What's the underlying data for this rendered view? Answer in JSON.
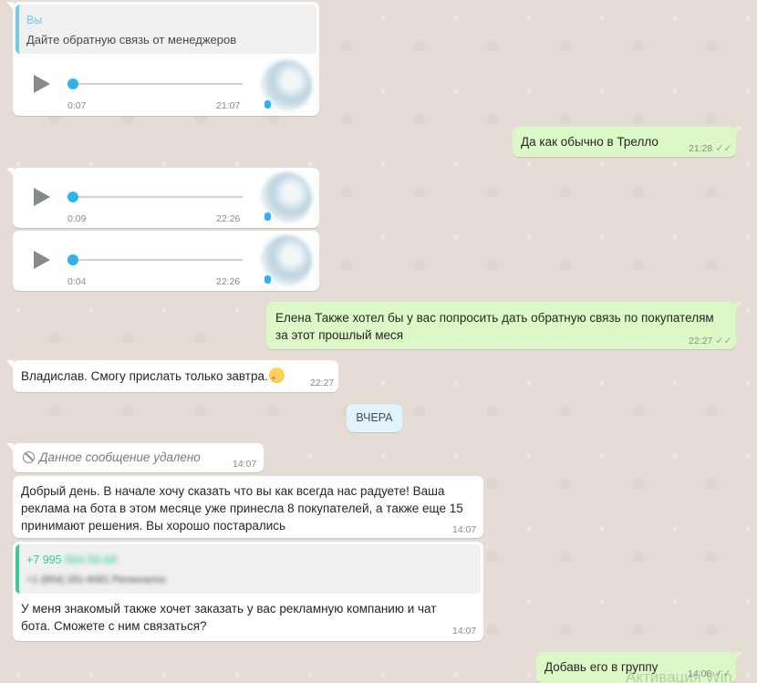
{
  "chat": {
    "msg1": {
      "quote_author": "Вы",
      "quote_text": "Дайте обратную связь от менеджеров",
      "voice_duration": "0:07",
      "time": "21:07"
    },
    "msg2": {
      "text": "Да как обычно в Трелло",
      "time": "21:28"
    },
    "msg3": {
      "voice_duration": "0:09",
      "time": "22:26"
    },
    "msg4": {
      "voice_duration": "0:04",
      "time": "22:26"
    },
    "msg5": {
      "line1": "Елена Также хотел бы у вас попросить дать обратную связь по покупателям",
      "line2": "за этот прошлый меся",
      "time": "22:27"
    },
    "msg6": {
      "text": "Владислав. Смогу прислать только завтра.",
      "time": "22:27"
    },
    "date_separator": "ВЧЕРА",
    "msg7": {
      "text": "Данное сообщение удалено",
      "time": "14:07"
    },
    "msg8": {
      "line1": "Добрый день. В начале хочу сказать что вы как всегда нас радуете! Ваша",
      "line2": "реклама на бота в этом месяце уже принесла 8 покупателей, а также еще 15",
      "line3": "принимают решения. Вы хорошо постарались",
      "time": "14:07"
    },
    "msg9": {
      "quote_phone": "+7 995",
      "quote_phone_hidden": "564-59-68",
      "quote_sub_hidden": "+1 (854) 281-6081 Регионалос",
      "line1": "У меня знакомый также хочет заказать у вас рекламную компанию и чат",
      "line2": "бота. Сможете с ним связаться?",
      "time": "14:07"
    },
    "msg10": {
      "text": "Добавь его в группу",
      "time": "14:08"
    }
  },
  "watermark": "Активация Win",
  "colors": {
    "background": "#e5ddd5",
    "incoming": "#ffffff",
    "outgoing": "#dcf8c6",
    "accent_blue": "#2db5ea",
    "quote_green": "#35cd96",
    "quote_blue": "#6bcbef"
  },
  "icons": [
    "play-icon",
    "mic-icon",
    "ban-icon",
    "double-check-icon",
    "emoji-icon"
  ]
}
